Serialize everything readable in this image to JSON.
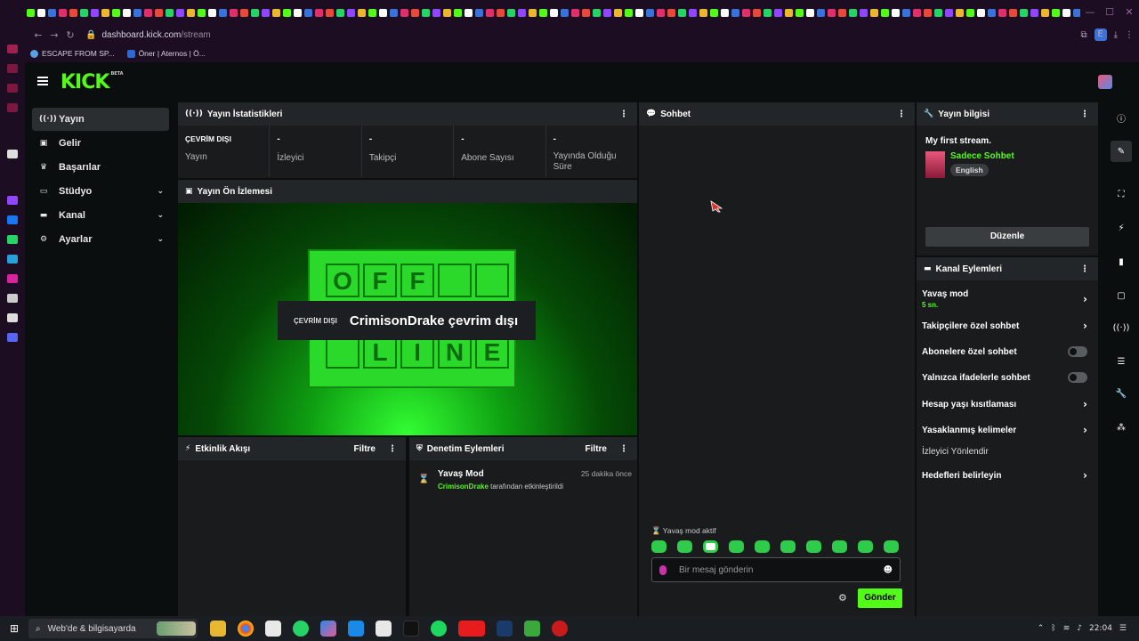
{
  "browser": {
    "url_host": "dashboard.kick.com",
    "url_path": "/stream",
    "profile_initial": "E",
    "bookmarks": [
      "ESCAPE FROM SP...",
      "Öner | Aternos | Ö..."
    ]
  },
  "app": {
    "logo": "KICK",
    "logo_badge": "BETA",
    "brand_color": "#53fc18"
  },
  "sidebar": {
    "items": [
      {
        "label": "Yayın",
        "icon": "broadcast-icon"
      },
      {
        "label": "Gelir",
        "icon": "dollar-icon"
      },
      {
        "label": "Başarılar",
        "icon": "trophy-icon"
      },
      {
        "label": "Stüdyo",
        "icon": "studio-icon"
      },
      {
        "label": "Kanal",
        "icon": "channel-icon"
      },
      {
        "label": "Ayarlar",
        "icon": "gear-icon"
      }
    ]
  },
  "stats_panel": {
    "title": "Yayın İstatistikleri",
    "status_badge": "ÇEVRİM DIŞI",
    "status_label": "Yayın",
    "stats": [
      {
        "value": "-",
        "label": "İzleyici"
      },
      {
        "value": "-",
        "label": "Takipçi"
      },
      {
        "value": "-",
        "label": "Abone Sayısı"
      },
      {
        "value": "-",
        "label": "Yayında Olduğu Süre"
      }
    ]
  },
  "preview_panel": {
    "title": "Yayın Ön İzlemesi",
    "offline_badge": "ÇEVRİM DIŞI",
    "offline_text": "CrimisonDrake çevrim dışı",
    "board_letters": [
      "O",
      "F",
      "F",
      "",
      "",
      "L",
      "I",
      "N",
      "E"
    ]
  },
  "activity_panel": {
    "title": "Etkinlik Akışı",
    "filter": "Filtre"
  },
  "moderation_panel": {
    "title": "Denetim Eylemleri",
    "filter": "Filtre",
    "entries": [
      {
        "title": "Yavaş Mod",
        "time": "25 dakika önce",
        "user": "CrimisonDrake",
        "action": "tarafından etkinleştirildi"
      }
    ]
  },
  "chat_panel": {
    "title": "Sohbet",
    "slow_mode_notice": "Yavaş mod aktif",
    "input_placeholder": "Bir mesaj gönderin",
    "send_label": "Gönder"
  },
  "stream_info": {
    "title": "Yayın bilgisi",
    "stream_title": "My first stream.",
    "category": "Sadece Sohbet",
    "language": "English",
    "edit_label": "Düzenle"
  },
  "channel_actions": {
    "title": "Kanal Eylemleri",
    "items": [
      {
        "label": "Yavaş mod",
        "sub": "5 sn.",
        "control": "arrow"
      },
      {
        "label": "Takipçilere özel sohbet",
        "control": "arrow"
      },
      {
        "label": "Abonelere özel sohbet",
        "control": "toggle"
      },
      {
        "label": "Yalnızca ifadelerle sohbet",
        "control": "toggle"
      },
      {
        "label": "Hesap yaşı kısıtlaması",
        "control": "arrow"
      },
      {
        "label": "Yasaklanmış kelimeler",
        "control": "arrow"
      },
      {
        "label": "İzleyici Yönlendir",
        "control": "none"
      },
      {
        "label": "Hedefleri belirleyin",
        "control": "arrow"
      }
    ]
  },
  "taskbar": {
    "search_label": "Web'de & bilgisayarda",
    "time": "22:04"
  }
}
